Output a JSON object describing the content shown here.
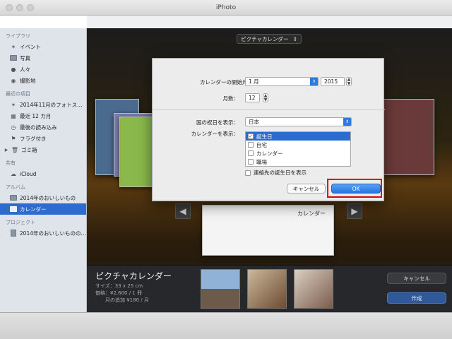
{
  "app": {
    "title": "iPhoto"
  },
  "sidebar": {
    "sections": [
      {
        "header": "ライブラリ",
        "items": [
          {
            "label": "イベント",
            "icon": "event-icon"
          },
          {
            "label": "写真",
            "icon": "photos-icon"
          },
          {
            "label": "人々",
            "icon": "people-icon"
          },
          {
            "label": "撮影地",
            "icon": "places-icon"
          }
        ]
      },
      {
        "header": "最近の項目",
        "items": [
          {
            "label": "2014年11月のフォトス…",
            "icon": "event-icon"
          },
          {
            "label": "最近 12 カ月",
            "icon": "calendar-icon"
          },
          {
            "label": "最後の読み込み",
            "icon": "clock-icon"
          },
          {
            "label": "フラグ付き",
            "icon": "flag-icon"
          },
          {
            "label": "ゴミ箱",
            "icon": "trash-icon"
          }
        ]
      },
      {
        "header": "共有",
        "items": [
          {
            "label": "iCloud",
            "icon": "icloud-icon"
          }
        ]
      },
      {
        "header": "アルバム",
        "items": [
          {
            "label": "2014年のおいしいもの",
            "icon": "album-icon"
          },
          {
            "label": "カレンダー",
            "icon": "album-icon",
            "selected": true
          }
        ]
      },
      {
        "header": "プロジェクト",
        "items": [
          {
            "label": "2014年のおいしいものの…",
            "icon": "project-icon"
          }
        ]
      }
    ]
  },
  "toolbar": {
    "theme_popup": "ピクチャカレンダー"
  },
  "preview": {
    "calendar_label": "カレンダー"
  },
  "bottom": {
    "title": "ピクチャカレンダー",
    "size": "サイズ：33 x 25 cm",
    "price": "価格：¥2,600 / 1 冊",
    "extra": "月の追加 ¥180 / 月",
    "cancel_label": "キャンセル",
    "create_label": "作成"
  },
  "dialog": {
    "start_month_label": "カレンダーの開始月：",
    "start_month_value": "1 月",
    "start_year_value": "2015",
    "months_label": "月数：",
    "months_value": "12",
    "holidays_label": "国の祝日を表示：",
    "holidays_value": "日本",
    "show_calendars_label": "カレンダーを表示：",
    "calendars": [
      {
        "label": "誕生日",
        "checked": true,
        "selected": true
      },
      {
        "label": "自宅",
        "checked": false
      },
      {
        "label": "カレンダー",
        "checked": false
      },
      {
        "label": "職場",
        "checked": false
      }
    ],
    "contacts_birthdays_label": "連絡先の誕生日を表示",
    "cancel_label": "キャンセル",
    "ok_label": "OK"
  },
  "colors": {
    "accent": "#2d6bd1",
    "highlight": "#e00000"
  }
}
